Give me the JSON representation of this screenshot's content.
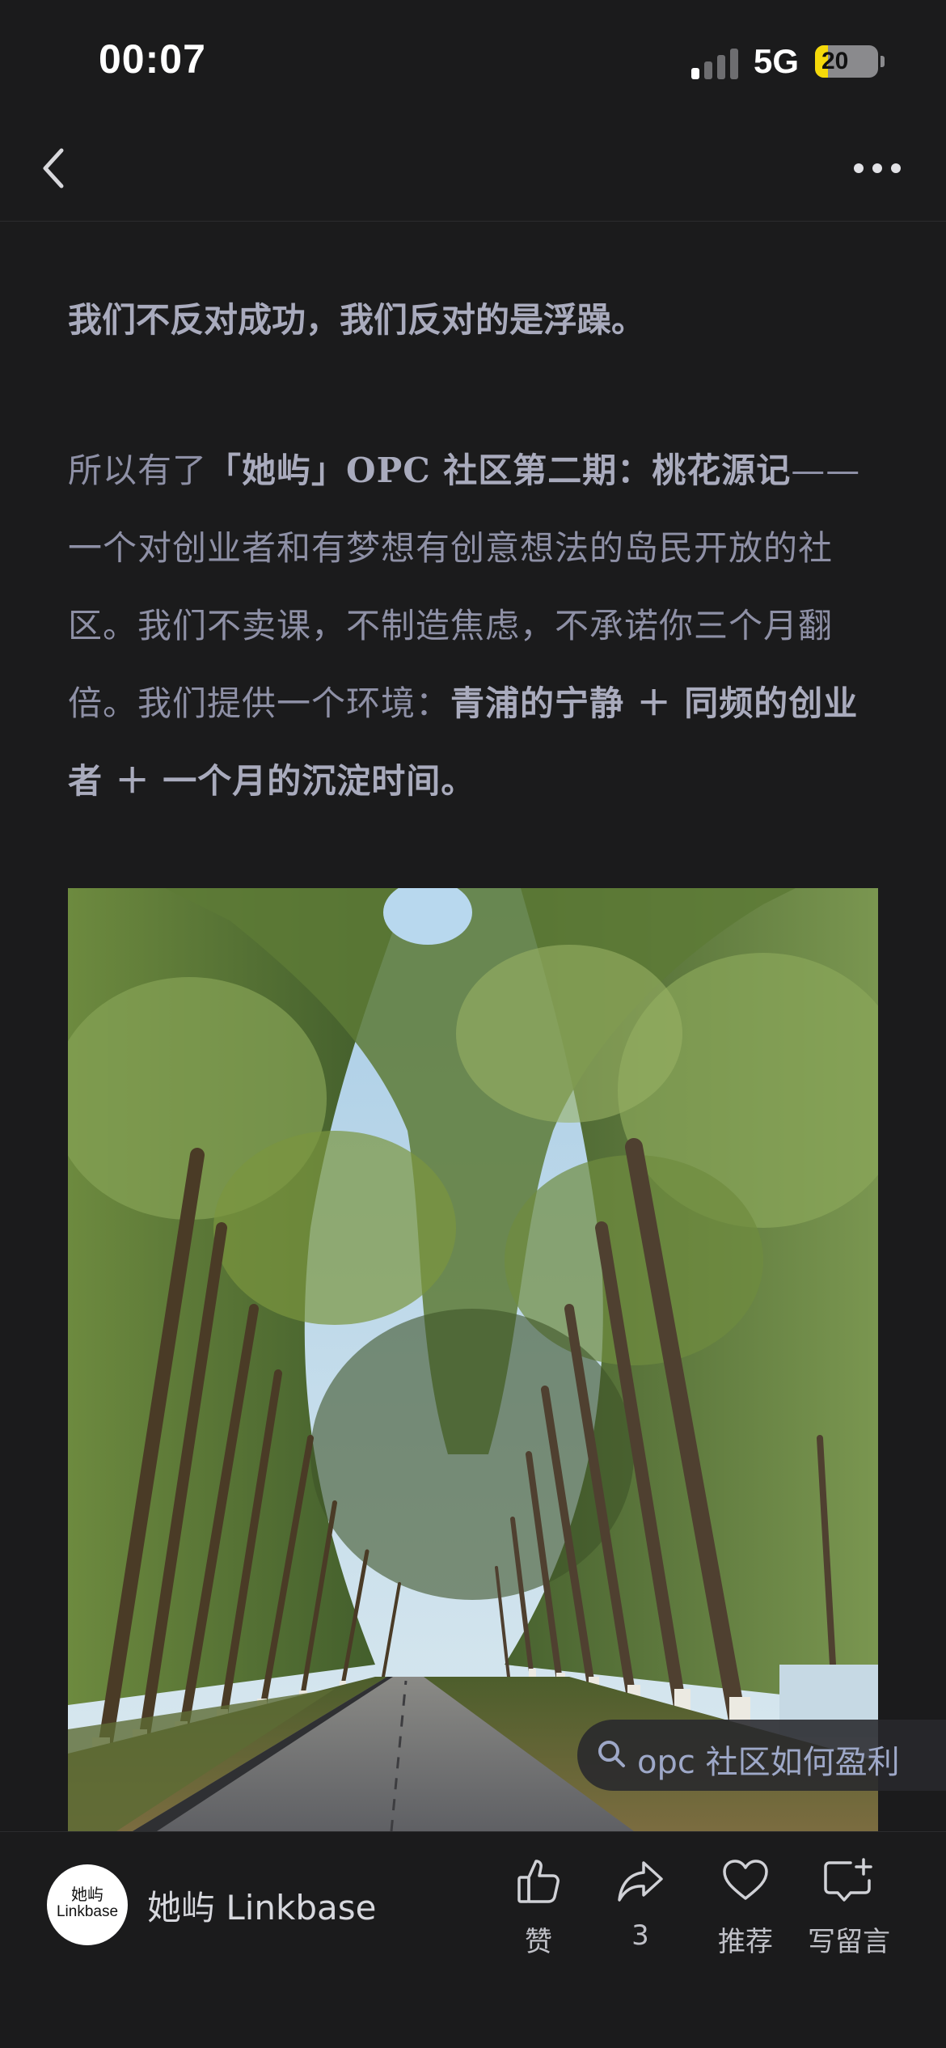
{
  "status_bar": {
    "time": "00:07",
    "network": "5G",
    "battery_level": "20",
    "battery_fraction": 0.2
  },
  "nav": {
    "back_icon": "chevron-left-icon",
    "more_icon": "more-dots-icon"
  },
  "article": {
    "p1": "我们不反对成功，我们反对的是浮躁。",
    "p2_a": "所以有了",
    "p2_b": "「她屿」",
    "p2_c": "OPC",
    "p2_d": " 社区第二期：桃花源记",
    "p2_e": "——一个对创业者和有梦想有创意想法的岛民开放的社区。我们不卖课，不制造焦虑，不承诺你三个月翻倍。我们提供一个环境：",
    "p2_f": "青浦的宁静 ＋ 同频的创业者 ＋ 一个月的沉淀时间。"
  },
  "search_chip": {
    "icon": "search-icon",
    "text": "opc 社区如何盈利"
  },
  "bottom_bar": {
    "avatar_line1": "她屿",
    "avatar_line2": "Linkbase",
    "account_name": "她屿 Linkbase",
    "actions": [
      {
        "icon": "thumbs-up-icon",
        "label": "赞"
      },
      {
        "icon": "share-icon",
        "label": "3"
      },
      {
        "icon": "heart-icon",
        "label": "推荐"
      },
      {
        "icon": "comment-icon",
        "label": "写留言"
      }
    ]
  },
  "colors": {
    "background": "#1b1b1c",
    "text_muted": "#8e90a6",
    "text_bold": "#a9abbd",
    "battery_accent": "#f5d90a"
  }
}
